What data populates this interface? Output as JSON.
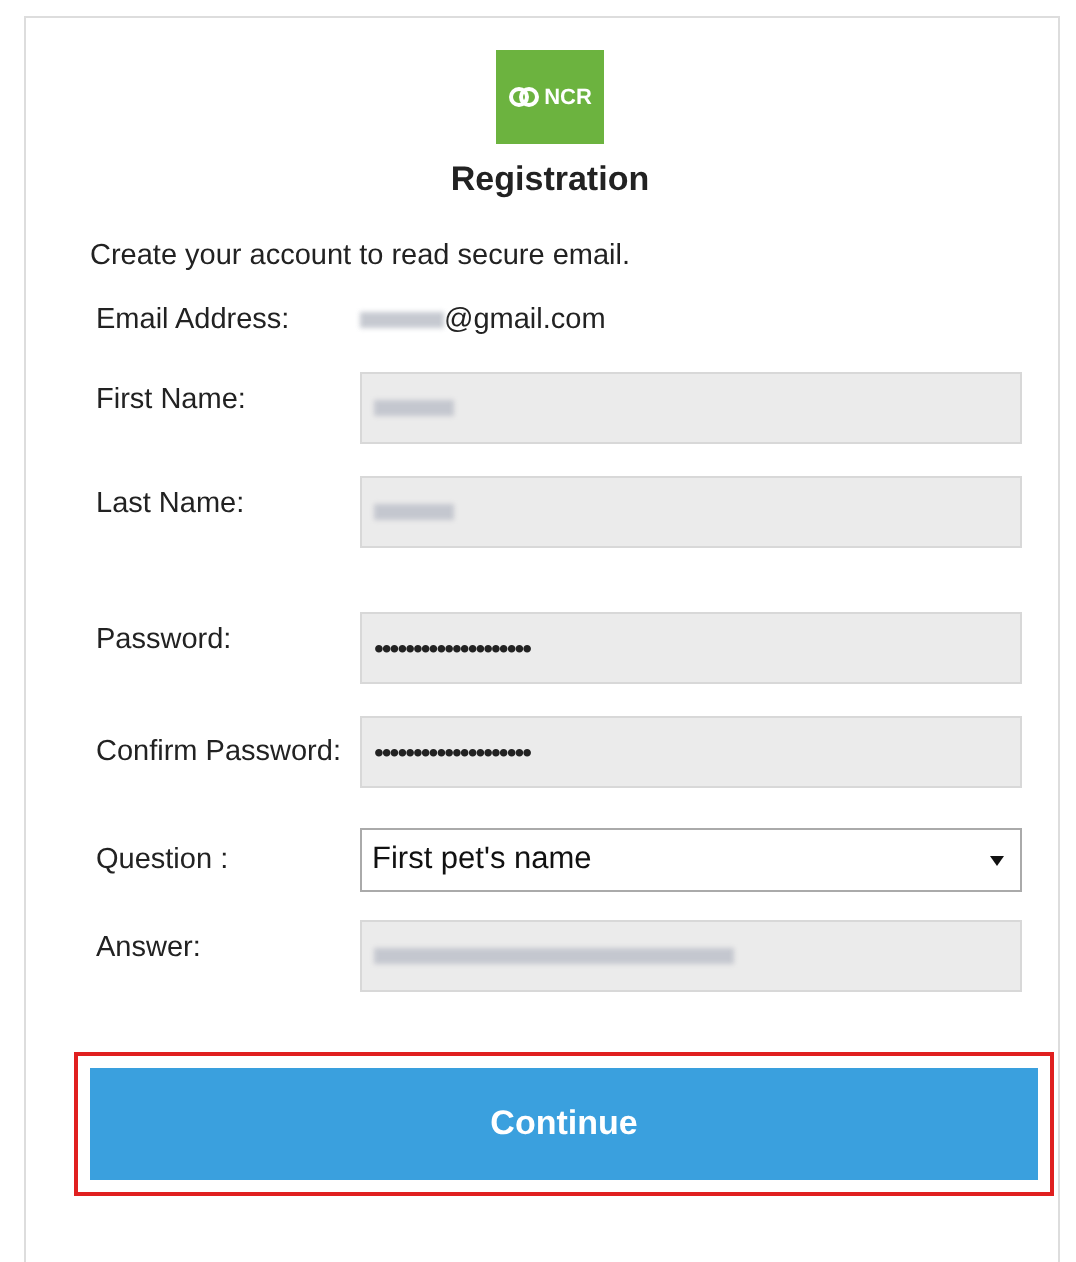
{
  "logo": {
    "text": "NCR"
  },
  "title": "Registration",
  "intro": "Create your account to read secure email.",
  "fields": [
    {
      "kind": "static",
      "label": "Email Address:",
      "value": "@gmail.com",
      "redacted": true
    },
    {
      "kind": "text",
      "label": "First Name:",
      "redacted": true
    },
    {
      "kind": "text",
      "label": "Last Name:",
      "redacted": true
    },
    {
      "kind": "password",
      "label": "Password:",
      "value": "••••••••••••••••••••"
    },
    {
      "kind": "password",
      "label": "Confirm Password:",
      "value": "••••••••••••••••••••"
    },
    {
      "kind": "select",
      "label": "Question :",
      "value": "First pet's name"
    },
    {
      "kind": "text",
      "label": "Answer:",
      "redacted": true
    }
  ],
  "button": {
    "label": "Continue",
    "highlighted": true
  }
}
